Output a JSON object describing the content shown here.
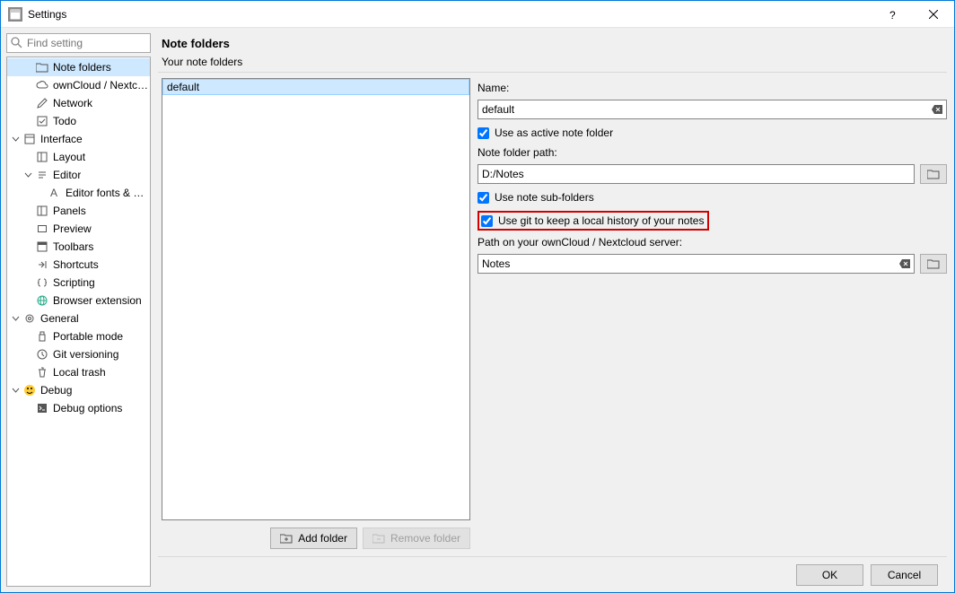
{
  "window": {
    "title": "Settings"
  },
  "search": {
    "placeholder": "Find setting"
  },
  "tree": [
    {
      "id": "note-folders",
      "label": "Note folders",
      "depth": 1,
      "twisty": "",
      "icon": "folder",
      "selected": true
    },
    {
      "id": "owncloud",
      "label": "ownCloud / Nextcl…",
      "depth": 1,
      "twisty": "",
      "icon": "cloud"
    },
    {
      "id": "network",
      "label": "Network",
      "depth": 1,
      "twisty": "",
      "icon": "pencil"
    },
    {
      "id": "todo",
      "label": "Todo",
      "depth": 1,
      "twisty": "",
      "icon": "todo"
    },
    {
      "id": "interface",
      "label": "Interface",
      "depth": 0,
      "twisty": "open",
      "icon": "window"
    },
    {
      "id": "layout",
      "label": "Layout",
      "depth": 1,
      "twisty": "",
      "icon": "panel"
    },
    {
      "id": "editor",
      "label": "Editor",
      "depth": 1,
      "twisty": "open",
      "icon": "text"
    },
    {
      "id": "fonts",
      "label": "Editor fonts & …",
      "depth": 2,
      "twisty": "",
      "icon": "font"
    },
    {
      "id": "panels",
      "label": "Panels",
      "depth": 1,
      "twisty": "",
      "icon": "panel"
    },
    {
      "id": "preview",
      "label": "Preview",
      "depth": 1,
      "twisty": "",
      "icon": "preview"
    },
    {
      "id": "toolbars",
      "label": "Toolbars",
      "depth": 1,
      "twisty": "",
      "icon": "toolbar"
    },
    {
      "id": "shortcuts",
      "label": "Shortcuts",
      "depth": 1,
      "twisty": "",
      "icon": "shortcuts"
    },
    {
      "id": "scripting",
      "label": "Scripting",
      "depth": 1,
      "twisty": "",
      "icon": "script"
    },
    {
      "id": "browser-ext",
      "label": "Browser extension",
      "depth": 1,
      "twisty": "",
      "icon": "globe"
    },
    {
      "id": "general",
      "label": "General",
      "depth": 0,
      "twisty": "open",
      "icon": "gear"
    },
    {
      "id": "portable",
      "label": "Portable mode",
      "depth": 1,
      "twisty": "",
      "icon": "usb"
    },
    {
      "id": "git",
      "label": "Git versioning",
      "depth": 1,
      "twisty": "",
      "icon": "clock"
    },
    {
      "id": "trash",
      "label": "Local trash",
      "depth": 1,
      "twisty": "",
      "icon": "trash"
    },
    {
      "id": "debug",
      "label": "Debug",
      "depth": 0,
      "twisty": "open",
      "icon": "smile"
    },
    {
      "id": "debug-opts",
      "label": "Debug options",
      "depth": 1,
      "twisty": "",
      "icon": "terminal"
    }
  ],
  "page": {
    "title": "Note folders",
    "subtitle": "Your note folders"
  },
  "folders": {
    "items": [
      "default"
    ],
    "add_label": "Add folder",
    "remove_label": "Remove folder"
  },
  "details": {
    "name_label": "Name:",
    "name_value": "default",
    "use_active_label": "Use as active note folder",
    "use_active_checked": true,
    "path_label": "Note folder path:",
    "path_value": "D:/Notes",
    "use_subfolders_label": "Use note sub-folders",
    "use_subfolders_checked": true,
    "use_git_label": "Use git to keep a local history of your notes",
    "use_git_checked": true,
    "server_path_label": "Path on your ownCloud / Nextcloud server:",
    "server_path_value": "Notes"
  },
  "footer": {
    "ok": "OK",
    "cancel": "Cancel"
  }
}
